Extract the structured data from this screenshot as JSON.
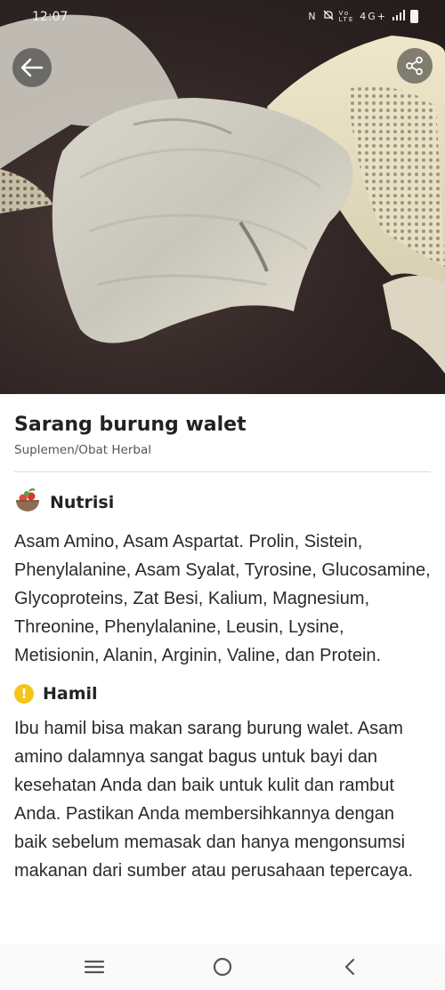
{
  "status_bar": {
    "time": "12:07",
    "icons": [
      "nfc-icon",
      "mute-icon",
      "volte-icon",
      "4g-icon",
      "signal-icon",
      "battery-icon"
    ],
    "network_text": "4G+"
  },
  "header": {
    "back_icon": "arrow-left-icon",
    "share_icon": "share-icon"
  },
  "product": {
    "name": "Sarang burung walet",
    "category": "Suplemen/Obat Herbal"
  },
  "sections": [
    {
      "icon": "nutrition-bowl-icon",
      "title": "Nutrisi",
      "body": "Asam Amino, Asam Aspartat. Prolin, Sistein, Phenylalanine, Asam Syalat, Tyrosine, Glucosamine, Glycoproteins, Zat Besi, Kalium, Magnesium, Threonine, Phenylalanine, Leusin, Lysine, Metisionin, Alanin, Arginin, Valine, dan Protein."
    },
    {
      "icon": "warning-icon",
      "icon_glyph": "!",
      "title": "Hamil",
      "body": "Ibu hamil bisa makan sarang burung walet. Asam amino dalamnya sangat bagus untuk bayi dan kesehatan Anda dan baik untuk kulit dan rambut Anda. Pastikan Anda membersihkannya dengan baik sebelum memasak dan hanya mengonsumsi makanan dari sumber atau perusahaan tepercaya."
    }
  ],
  "colors": {
    "warning": "#f5c518",
    "hero_background": "#2f2524",
    "nest": "#e8e2d2"
  },
  "nav_bar": {
    "icons": [
      "recent-apps-icon",
      "home-icon",
      "back-nav-icon"
    ]
  }
}
